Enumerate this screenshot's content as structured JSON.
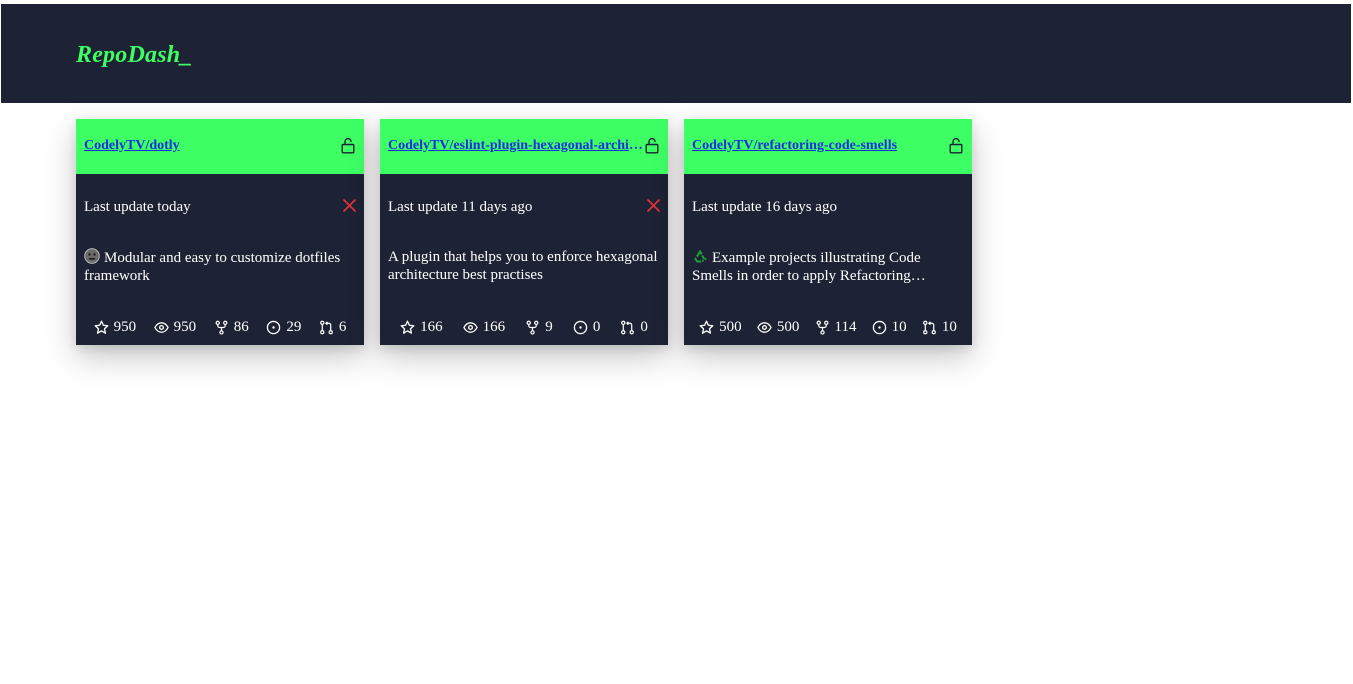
{
  "app": {
    "logo": "RepoDash_"
  },
  "colors": {
    "header_bg": "#1d2234",
    "accent": "#3dff63",
    "link": "#1b2fe0",
    "error": "#e0313b",
    "text": "#ffffff"
  },
  "repos": [
    {
      "name": "CodelyTV/dotly",
      "visibility_icon": "lock-open-icon",
      "last_update": "Last update today",
      "status_icon": "x-icon",
      "description_emoji_icon": "robot-face-icon",
      "description": "Modular and easy to customize dotfiles framework",
      "stars": "950",
      "watchers": "950",
      "forks": "86",
      "issues": "29",
      "pull_requests": "6"
    },
    {
      "name": "CodelyTV/eslint-plugin-hexagonal-architecture",
      "visibility_icon": "lock-open-icon",
      "last_update": "Last update 11 days ago",
      "status_icon": "x-icon",
      "description": "A plugin that helps you to enforce hexagonal architecture best practises",
      "stars": "166",
      "watchers": "166",
      "forks": "9",
      "issues": "0",
      "pull_requests": "0"
    },
    {
      "name": "CodelyTV/refactoring-code-smells",
      "visibility_icon": "lock-open-icon",
      "last_update": "Last update 16 days ago",
      "description_emoji_icon": "recycle-icon",
      "description": "Example projects illustrating Code Smells in order to apply Refactoring techniques",
      "stars": "500",
      "watchers": "500",
      "forks": "114",
      "issues": "10",
      "pull_requests": "10"
    }
  ]
}
